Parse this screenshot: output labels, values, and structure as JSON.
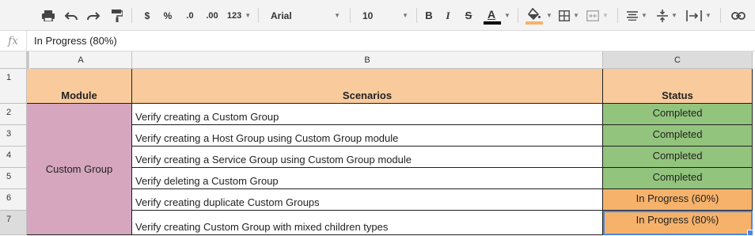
{
  "toolbar": {
    "currency": "$",
    "percent": "%",
    "decrease_decimal": ".0",
    "increase_decimal": ".00",
    "more_formats": "123",
    "font": "Arial",
    "font_size": "10",
    "bold": "B",
    "italic": "I",
    "strike": "S",
    "text_color": "A",
    "icons": [
      "print-icon",
      "undo-icon",
      "redo-icon",
      "paint-format-icon",
      "fill-color-icon",
      "borders-icon",
      "merge-cells-icon",
      "horizontal-align-icon",
      "vertical-align-icon",
      "text-wrap-icon",
      "link-icon"
    ],
    "text_color_swatch": "#000000",
    "fill_color_swatch": "#f6b26b"
  },
  "formula_bar": {
    "fx": "fx",
    "value": "In Progress (80%)"
  },
  "columns": [
    "A",
    "B",
    "C"
  ],
  "rows": [
    "1",
    "2",
    "3",
    "4",
    "5",
    "6",
    "7"
  ],
  "header": {
    "module": "Module",
    "scenarios": "Scenarios",
    "status": "Status"
  },
  "module_value": "Custom Group",
  "scenarios": [
    "Verify creating a Custom Group",
    "Verify creating a Host Group using Custom Group module",
    "Verify creating a Service Group using Custom Group module",
    "Verify deleting a Custom Group",
    "Verify creating duplicate Custom Groups",
    "Verify creating Custom Group with mixed children types"
  ],
  "statuses": [
    "Completed",
    "Completed",
    "Completed",
    "Completed",
    "In Progress (60%)",
    "In Progress (80%)"
  ],
  "colors": {
    "header_fill": "#f9cb9c",
    "module_fill": "#d5a6bd",
    "completed_fill": "#93c47d",
    "in_progress_fill": "#f6b26b",
    "selection": "#4a86e8"
  }
}
